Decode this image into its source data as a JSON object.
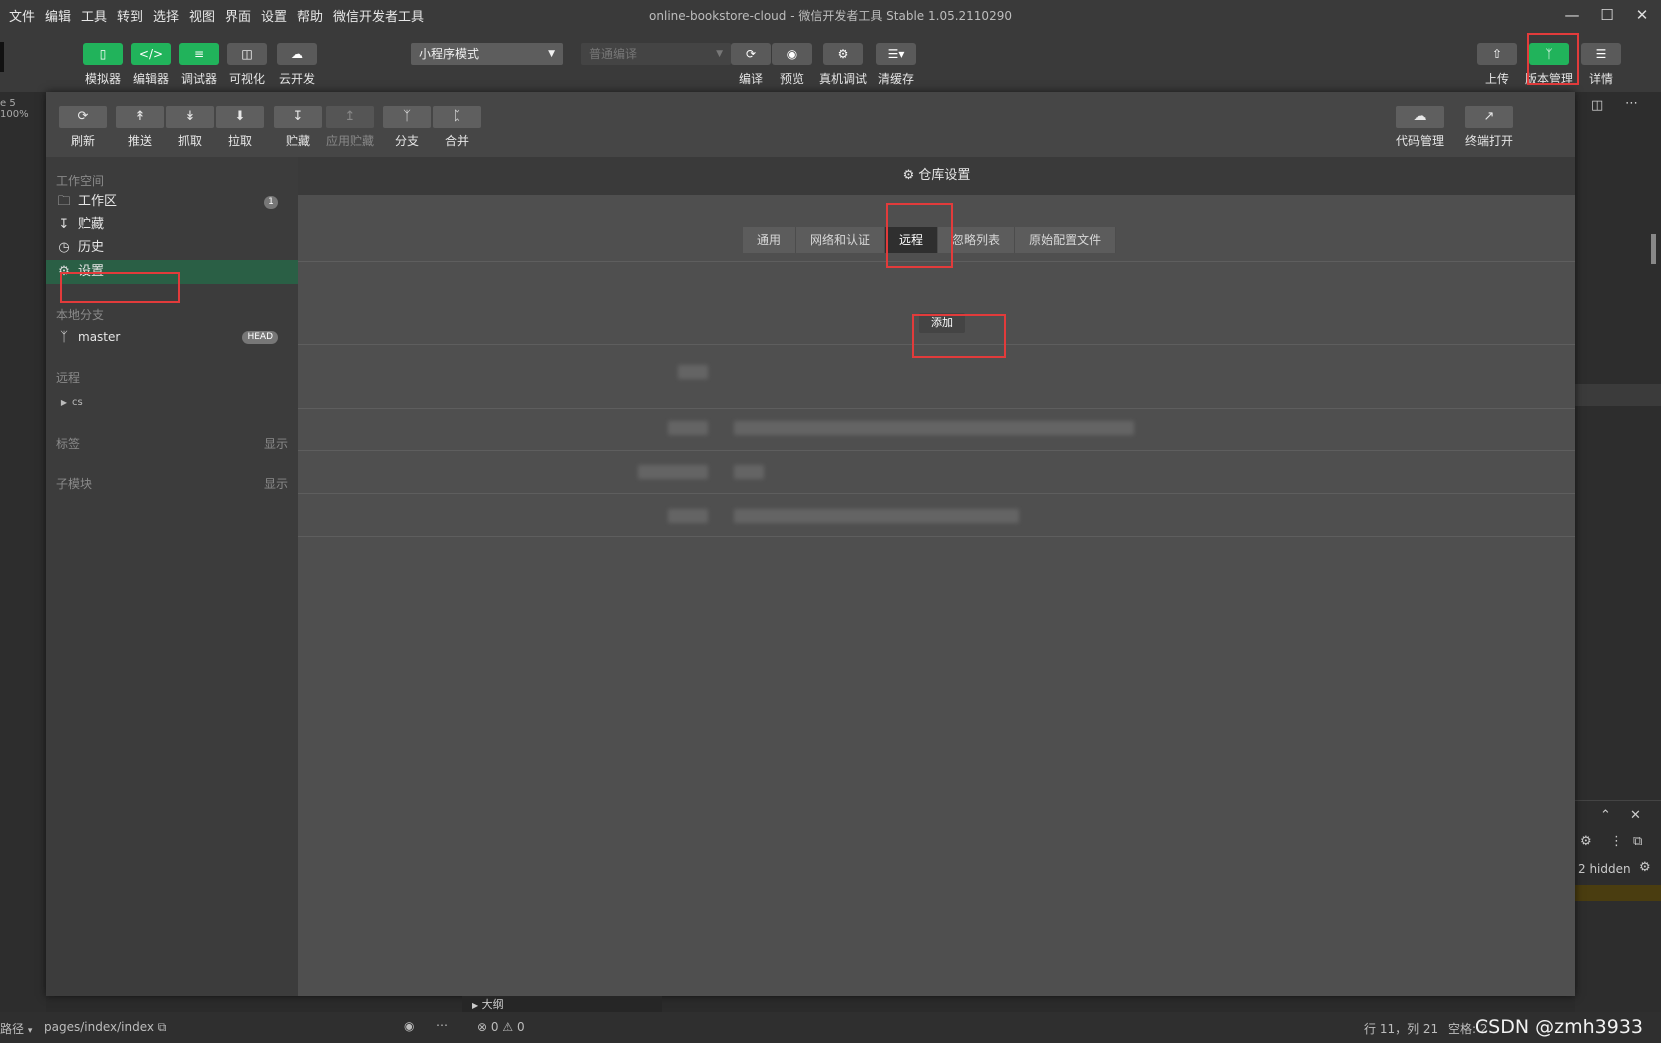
{
  "menu": [
    "文件",
    "编辑",
    "工具",
    "转到",
    "选择",
    "视图",
    "界面",
    "设置",
    "帮助",
    "微信开发者工具"
  ],
  "window_title": "online-bookstore-cloud - 微信开发者工具 Stable 1.05.2110290",
  "toolbar": {
    "left_buttons": [
      {
        "label": "模拟器",
        "icon": "phone-icon"
      },
      {
        "label": "编辑器",
        "icon": "code-icon"
      },
      {
        "label": "调试器",
        "icon": "sliders-icon"
      },
      {
        "label": "可视化",
        "icon": "layout-icon"
      },
      {
        "label": "云开发",
        "icon": "cloud-icon"
      }
    ],
    "mode_select": "小程序模式",
    "compile_select": "普通编译",
    "mid_buttons": [
      {
        "label": "编译",
        "icon": "refresh-icon"
      },
      {
        "label": "预览",
        "icon": "eye-icon"
      },
      {
        "label": "真机调试",
        "icon": "bug-icon"
      },
      {
        "label": "清缓存",
        "icon": "layers-icon"
      }
    ],
    "right_buttons": [
      {
        "label": "上传",
        "icon": "upload-icon"
      },
      {
        "label": "版本管理",
        "icon": "branch-icon"
      },
      {
        "label": "详情",
        "icon": "menu-icon"
      }
    ]
  },
  "editor_zoom": "e 5 100%",
  "vcs_toolbar": {
    "buttons": [
      "刷新",
      "推送",
      "抓取",
      "拉取",
      "贮藏",
      "应用贮藏",
      "分支",
      "合并"
    ],
    "right_buttons": [
      "代码管理",
      "终端打开"
    ]
  },
  "sidebar": {
    "workspace_header": "工作空间",
    "items": [
      {
        "label": "工作区",
        "badge": "1"
      },
      {
        "label": "贮藏"
      },
      {
        "label": "历史"
      },
      {
        "label": "设置"
      }
    ],
    "local_branch_header": "本地分支",
    "branch": {
      "name": "master",
      "badge": "HEAD"
    },
    "remote_header": "远程",
    "remote_item": "cs",
    "tags_header": "标签",
    "tags_action": "显示",
    "submodule_header": "子模块",
    "submodule_action": "显示"
  },
  "content": {
    "title": "仓库设置",
    "tabs": [
      "通用",
      "网络和认证",
      "远程",
      "忽略列表",
      "原始配置文件"
    ],
    "active_tab": "远程",
    "add_button": "添加"
  },
  "bottom_right": {
    "hidden": "2 hidden"
  },
  "outline": "大纲",
  "status": {
    "path_label": "路径",
    "path": "pages/index/index",
    "errors": "0",
    "warnings": "0",
    "cursor": "行 11，列 21",
    "spaces": "空格: 2",
    "watermark": "CSDN @zmh3933"
  }
}
